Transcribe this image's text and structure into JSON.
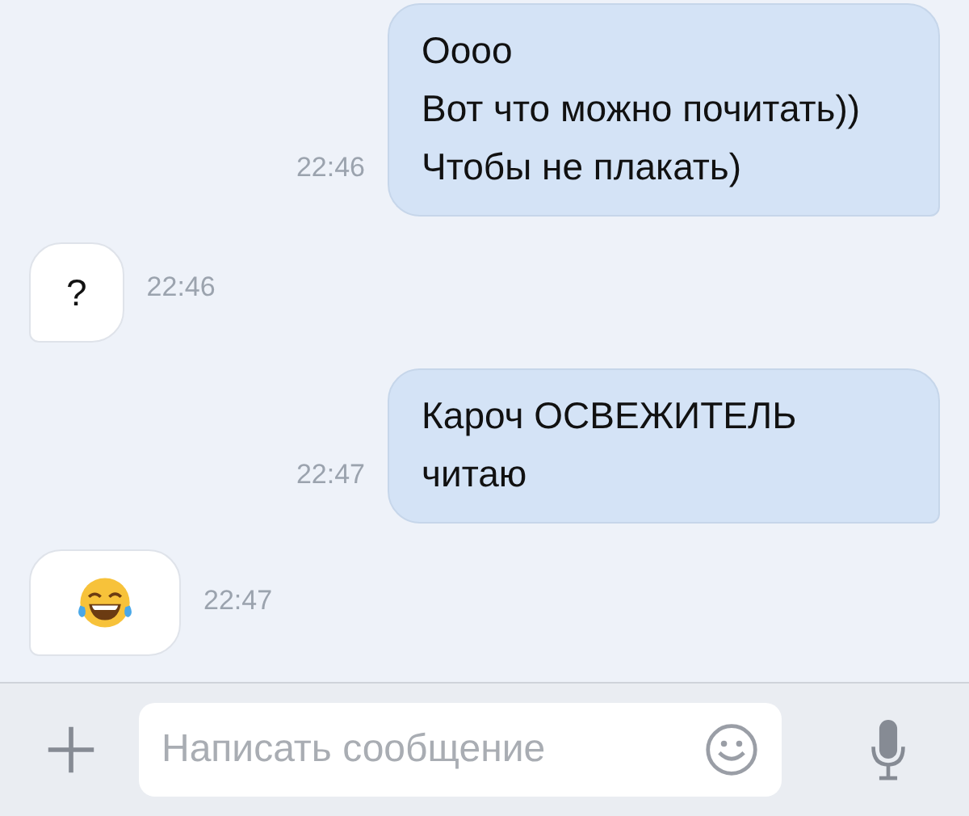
{
  "messages": [
    {
      "kind": "text",
      "outgoing": true,
      "lines": [
        "Оооо",
        "Вот что можно почитать))",
        "Чтобы не плакать)"
      ],
      "time": "22:46"
    },
    {
      "kind": "text",
      "outgoing": false,
      "lines": [
        "?"
      ],
      "time": "22:46"
    },
    {
      "kind": "text",
      "outgoing": true,
      "lines": [
        "Кароч ОСВЕЖИТЕЛЬ",
        "читаю"
      ],
      "time": "22:47"
    },
    {
      "kind": "emoji",
      "outgoing": false,
      "time": "22:47"
    }
  ],
  "composer": {
    "placeholder": "Написать сообщение"
  }
}
